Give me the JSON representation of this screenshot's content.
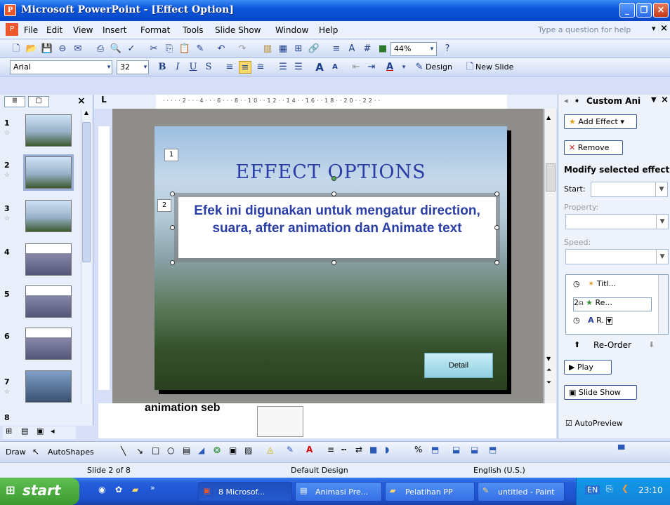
{
  "window": {
    "title": "Microsoft PowerPoint - [Effect Option]",
    "min": "_",
    "max": "❐",
    "close": "✕"
  },
  "menu": {
    "items": [
      "File",
      "Edit",
      "View",
      "Insert",
      "Format",
      "Tools",
      "Slide Show",
      "Window",
      "Help"
    ],
    "help_placeholder": "Type a question for help",
    "close": "×"
  },
  "standard_toolbar": {
    "zoom": "44%"
  },
  "formatting_toolbar": {
    "font": "Arial",
    "size": "32",
    "design": "Design",
    "new_slide": "New Slide"
  },
  "left_pane": {
    "close": "×",
    "slides": [
      {
        "num": "1"
      },
      {
        "num": "2"
      },
      {
        "num": "3"
      },
      {
        "num": "4"
      },
      {
        "num": "5"
      },
      {
        "num": "6"
      },
      {
        "num": "7"
      },
      {
        "num": "8"
      }
    ]
  },
  "slide": {
    "title": "EFFECT OPTIONS",
    "body": "Efek ini digunakan untuk mengatur direction, suara, after animation dan Animate text",
    "tag1": "1",
    "tag2": "2",
    "button": "Detail"
  },
  "notes": {
    "text": "animation    seb"
  },
  "task_pane": {
    "title": "Custom Ani",
    "add_effect": "Add Effect",
    "remove": "Remove",
    "modify_heading": "Modify selected effect",
    "start_label": "Start:",
    "property_label": "Property:",
    "speed_label": "Speed:",
    "list": [
      {
        "index": "",
        "label": "Titl..."
      },
      {
        "index": "2",
        "label": "Re..."
      },
      {
        "index": "",
        "label": "R."
      }
    ],
    "reorder": "Re-Order",
    "play": "Play",
    "slide_show": "Slide Show",
    "autopreview": "AutoPreview"
  },
  "draw_toolbar": {
    "draw": "Draw",
    "autoshapes": "AutoShapes"
  },
  "status": {
    "slide": "Slide 2 of 8",
    "design": "Default Design",
    "language": "English (U.S.)"
  },
  "taskbar": {
    "start": "start",
    "tasks": [
      "8 Microsof...",
      "Animasi Pre...",
      "Pelatihan PP",
      "untitled - Paint"
    ],
    "lang": "EN",
    "time": "23:10"
  }
}
